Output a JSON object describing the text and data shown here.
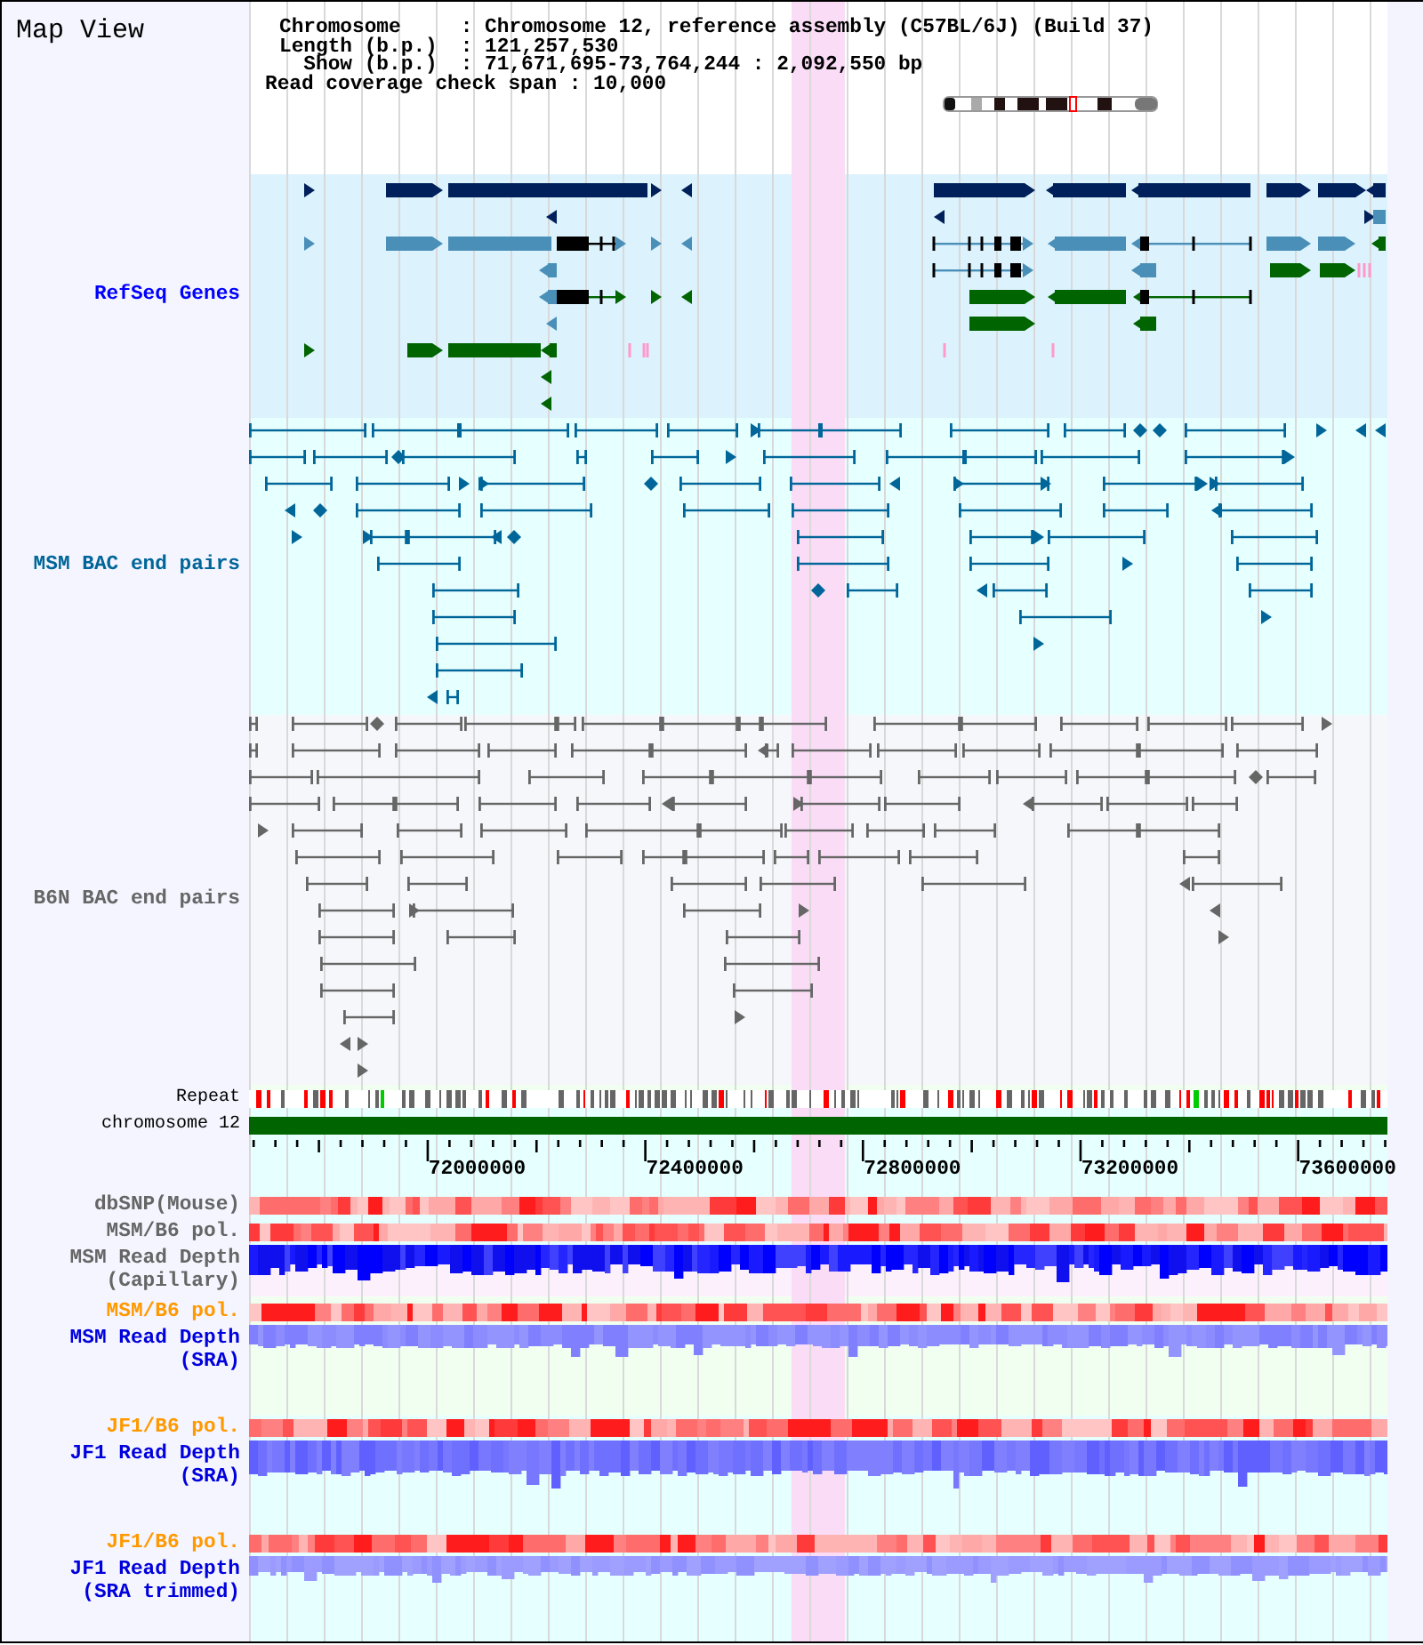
{
  "header": {
    "title": "Map View",
    "info": [
      {
        "label": "Chromosome",
        "value": ": Chromosome 12, reference assembly (C57BL/6J) (Build 37)"
      },
      {
        "label": "Length (b.p.)",
        "value": ": 121,257,530"
      },
      {
        "label": "Show (b.p.)",
        "value": ": 71,671,695-73,764,244 : 2,092,550 bp"
      }
    ],
    "coverage": "Read coverage check span : 10,000"
  },
  "tracks": [
    {
      "kind": "genes",
      "label": "RefSeq Genes",
      "color": "#0000ff"
    },
    {
      "kind": "bac_pairs",
      "label": "MSM BAC end pairs",
      "color": "#006699"
    },
    {
      "kind": "bac_pairs",
      "label": "B6N BAC end pairs",
      "color": "#666666"
    },
    {
      "kind": "repeat",
      "label": "Repeat",
      "color": "#000000"
    },
    {
      "kind": "chromosome",
      "label": "chromosome 12",
      "color": "#000000"
    },
    {
      "kind": "axis",
      "ticks": [
        "72000000",
        "72400000",
        "72800000",
        "73200000",
        "73600000"
      ]
    },
    {
      "kind": "snp",
      "label": "dbSNP(Mouse)",
      "color": "#666666"
    },
    {
      "kind": "pol",
      "label": "MSM/B6 pol.",
      "color": "#666666"
    },
    {
      "kind": "depth",
      "label": "MSM Read Depth (Capillary)",
      "color": "#666666"
    },
    {
      "kind": "pol",
      "label": "MSM/B6 pol.",
      "color": "#ff9900"
    },
    {
      "kind": "depth",
      "label": "MSM Read Depth (SRA)",
      "color": "#0000dd"
    },
    {
      "kind": "pol",
      "label": "JF1/B6 pol.",
      "color": "#ff9900"
    },
    {
      "kind": "depth",
      "label": "JF1 Read Depth (SRA)",
      "color": "#0000dd"
    },
    {
      "kind": "pol",
      "label": "JF1/B6 pol.",
      "color": "#ff9900"
    },
    {
      "kind": "depth",
      "label": "JF1 Read Depth (SRA trimmed)",
      "color": "#0000dd"
    }
  ]
}
